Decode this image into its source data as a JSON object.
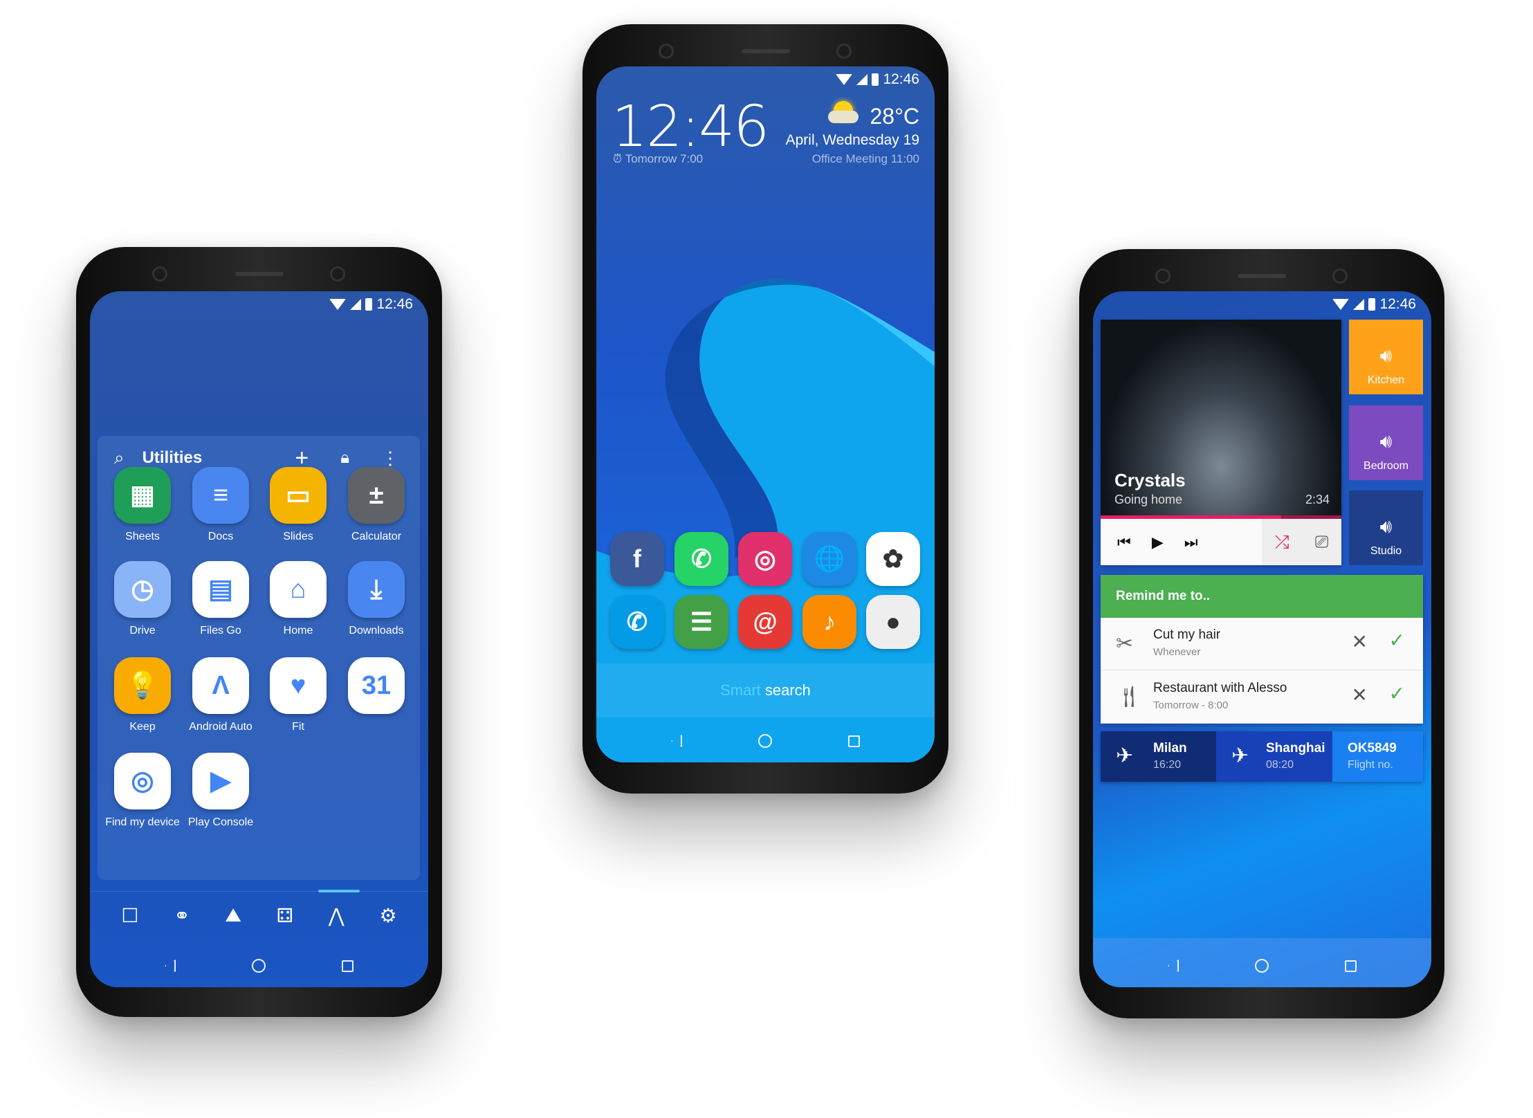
{
  "status_time": "12:46",
  "left_phone": {
    "folder_title": "Utilities",
    "apps": [
      {
        "label": "Sheets",
        "icon": "sheets-icon",
        "glyph": "▦",
        "color": "#1e9e57"
      },
      {
        "label": "Docs",
        "icon": "docs-icon",
        "glyph": "≡",
        "color": "#4a86f0"
      },
      {
        "label": "Slides",
        "icon": "slides-icon",
        "glyph": "▭",
        "color": "#f4b400"
      },
      {
        "label": "Calculator",
        "icon": "calculator-icon",
        "glyph": "±",
        "color": "#5f6368"
      },
      {
        "label": "Drive",
        "icon": "clock-icon",
        "glyph": "◷",
        "color": "#8ab4f8"
      },
      {
        "label": "Files Go",
        "icon": "files-go-icon",
        "glyph": "▤",
        "color": "#ffffff"
      },
      {
        "label": "Home",
        "icon": "home-icon",
        "glyph": "⌂",
        "color": "#ffffff"
      },
      {
        "label": "Downloads",
        "icon": "downloads-icon",
        "glyph": "⤓",
        "color": "#4a86f0"
      },
      {
        "label": "Keep",
        "icon": "keep-icon",
        "glyph": "💡",
        "color": "#f9ab00"
      },
      {
        "label": "Android Auto",
        "icon": "android-auto-icon",
        "glyph": "Λ",
        "color": "#ffffff"
      },
      {
        "label": "Fit",
        "icon": "fit-icon",
        "glyph": "♥",
        "color": "#ffffff"
      },
      {
        "label": "",
        "icon": "calendar-icon",
        "glyph": "31",
        "color": "#ffffff"
      },
      {
        "label": "Find my device",
        "icon": "find-my-device-icon",
        "glyph": "◎",
        "color": "#ffffff"
      },
      {
        "label": "Play Console",
        "icon": "play-console-icon",
        "glyph": "▶",
        "color": "#ffffff"
      }
    ],
    "dock": [
      {
        "icon": "chat-icon",
        "glyph": "☐"
      },
      {
        "icon": "share-icon",
        "glyph": "⚭"
      },
      {
        "icon": "gallery-icon",
        "glyph": "⛰"
      },
      {
        "icon": "games-icon",
        "glyph": "⚃"
      },
      {
        "icon": "tools-icon",
        "glyph": "⋀"
      },
      {
        "icon": "settings-icon",
        "glyph": "⚙"
      }
    ]
  },
  "center_phone": {
    "clock": "12:46",
    "alarm": "Tomorrow 7:00",
    "temperature": "28°C",
    "date": "April, Wednesday 19",
    "event": "Office Meeting 11:00",
    "weather_icon": "partly-cloudy-icon",
    "apps": [
      {
        "icon": "facebook-icon",
        "glyph": "f",
        "color": "#3b5998"
      },
      {
        "icon": "whatsapp-icon",
        "glyph": "✆",
        "color": "#25d366"
      },
      {
        "icon": "instagram-icon",
        "glyph": "◎",
        "color": "#e1306c"
      },
      {
        "icon": "browser-globe-icon",
        "glyph": "🌐",
        "color": "#1e88e5"
      },
      {
        "icon": "lotus-icon",
        "glyph": "✿",
        "color": "#ffffff"
      },
      {
        "icon": "phone-icon",
        "glyph": "✆",
        "color": "#039be5"
      },
      {
        "icon": "messages-icon",
        "glyph": "☰",
        "color": "#43a047"
      },
      {
        "icon": "email-icon",
        "glyph": "@",
        "color": "#e53935"
      },
      {
        "icon": "music-icon",
        "glyph": "♪",
        "color": "#fb8c00"
      },
      {
        "icon": "camera-icon",
        "glyph": "●",
        "color": "#eeeeee"
      }
    ],
    "search_prefix": "Smart",
    "search_suffix": " search"
  },
  "right_phone": {
    "track_title": "Crystals",
    "track_subtitle": "Going home",
    "track_time": "2:34",
    "progress_percent": 75,
    "accent": "#e91e63",
    "speakers": [
      {
        "label": "Kitchen",
        "color": "#ffa21a"
      },
      {
        "label": "Bedroom",
        "color": "#7b4bbf"
      },
      {
        "label": "Studio",
        "color": "#1f3f8a"
      }
    ],
    "reminder_header": "Remind me to..",
    "reminders": [
      {
        "title": "Cut my hair",
        "subtitle": "Whenever",
        "icon": "scissors-icon"
      },
      {
        "title": "Restaurant with Alesso",
        "subtitle": "Tomorrow - 8:00",
        "icon": "restaurant-icon"
      }
    ],
    "flight": {
      "from_city": "Milan",
      "from_time": "16:20",
      "to_city": "Shanghai",
      "to_time": "08:20",
      "number": "OK5849",
      "number_label": "Flight no."
    }
  }
}
